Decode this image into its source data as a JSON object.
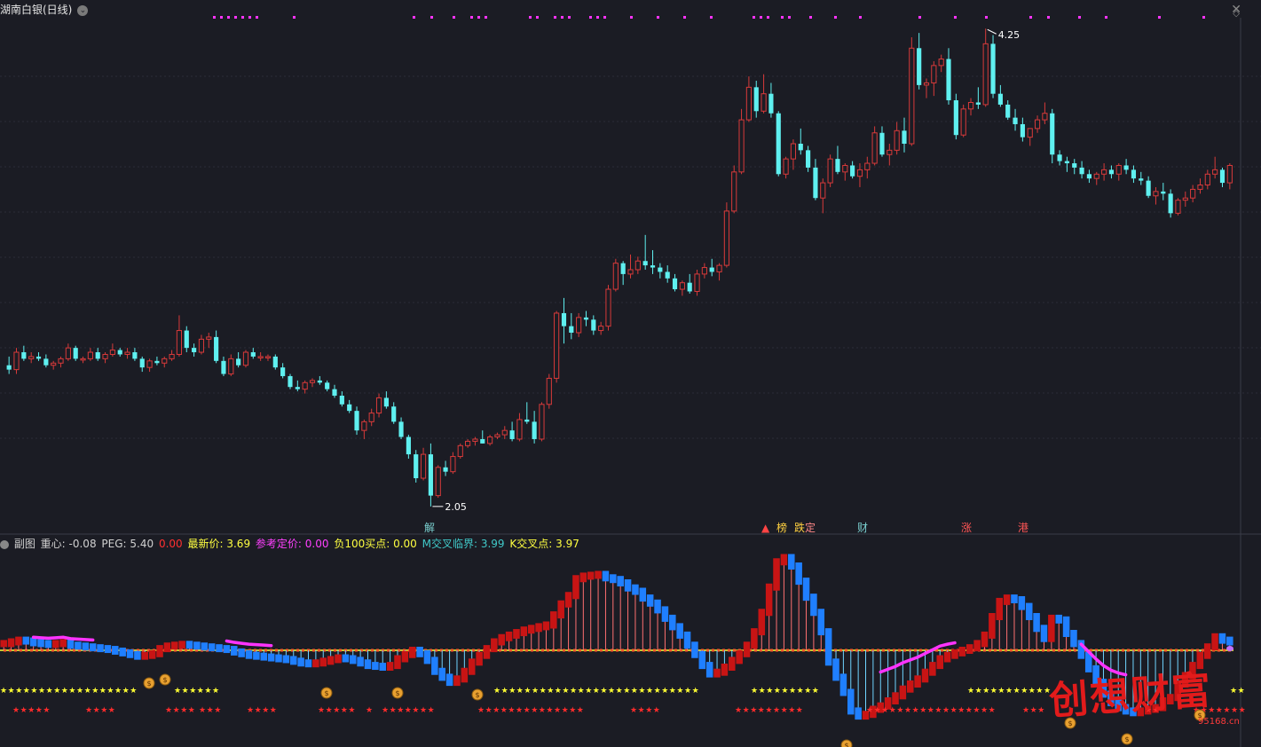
{
  "header": {
    "title": "湖南白银(日线)",
    "close_glyph": "✕",
    "diamond_glyph": "◇"
  },
  "colors": {
    "background": "#1b1c24",
    "up": "#d83a3a",
    "down": "#5ff0f0",
    "grid": "#2b2d38",
    "magenta": "#ff33ff",
    "yellow": "#ffff33",
    "red_star": "#ff2b2b",
    "blue_bar": "#1f7fff",
    "dark_red_bar": "#c81414"
  },
  "markers": {
    "high_label": "4.25",
    "low_label": "2.05",
    "event_tags": [
      {
        "text": "解",
        "color": "#7ad0d0"
      },
      {
        "text": "▲",
        "color": "#ff4444"
      },
      {
        "text": "榜",
        "color": "#ffd040"
      },
      {
        "text": "跌",
        "color": "#ffd040"
      },
      {
        "text": "定",
        "color": "#ff8888"
      },
      {
        "text": "财",
        "color": "#7ad0d0"
      },
      {
        "text": "涨",
        "color": "#ff5555"
      },
      {
        "text": "港",
        "color": "#ff5555"
      }
    ]
  },
  "sub_legend": [
    {
      "text": "副图",
      "color": "#d0d0d0"
    },
    {
      "text": "重心: -0.08",
      "color": "#d0d0d0"
    },
    {
      "text": "PEG: 5.40",
      "color": "#d0d0d0"
    },
    {
      "text": "0.00",
      "color": "#ff3030"
    },
    {
      "text": "最新价: 3.69",
      "color": "#ffff40"
    },
    {
      "text": "参考定价: 0.00",
      "color": "#ff40ff"
    },
    {
      "text": "负100买点: 0.00",
      "color": "#ffff40"
    },
    {
      "text": "M交叉临界: 3.99",
      "color": "#40c8c8"
    },
    {
      "text": "K交叉点: 3.97",
      "color": "#ffff40"
    }
  ],
  "watermark": {
    "text": "创想财富",
    "url": "95168.cn"
  },
  "chart_data": [
    {
      "type": "candlestick",
      "title": "湖南白银(日线)",
      "annotations": [
        {
          "label": "4.25",
          "kind": "max"
        },
        {
          "label": "2.05",
          "kind": "min"
        }
      ],
      "ohlc": [
        [
          2.7,
          2.74,
          2.66,
          2.68
        ],
        [
          2.68,
          2.78,
          2.66,
          2.76
        ],
        [
          2.76,
          2.79,
          2.72,
          2.73
        ],
        [
          2.73,
          2.76,
          2.71,
          2.74
        ],
        [
          2.74,
          2.76,
          2.72,
          2.73
        ],
        [
          2.73,
          2.75,
          2.69,
          2.7
        ],
        [
          2.7,
          2.72,
          2.68,
          2.71
        ],
        [
          2.71,
          2.74,
          2.69,
          2.73
        ],
        [
          2.73,
          2.8,
          2.72,
          2.78
        ],
        [
          2.78,
          2.79,
          2.72,
          2.73
        ],
        [
          2.73,
          2.74,
          2.71,
          2.73
        ],
        [
          2.73,
          2.78,
          2.72,
          2.76
        ],
        [
          2.76,
          2.78,
          2.72,
          2.73
        ],
        [
          2.73,
          2.76,
          2.71,
          2.75
        ],
        [
          2.75,
          2.8,
          2.74,
          2.77
        ],
        [
          2.77,
          2.78,
          2.74,
          2.75
        ],
        [
          2.75,
          2.78,
          2.73,
          2.76
        ],
        [
          2.76,
          2.78,
          2.72,
          2.73
        ],
        [
          2.73,
          2.74,
          2.67,
          2.69
        ],
        [
          2.69,
          2.73,
          2.67,
          2.72
        ],
        [
          2.72,
          2.74,
          2.7,
          2.71
        ],
        [
          2.71,
          2.74,
          2.69,
          2.73
        ],
        [
          2.73,
          2.77,
          2.72,
          2.75
        ],
        [
          2.75,
          2.93,
          2.74,
          2.86
        ],
        [
          2.86,
          2.88,
          2.76,
          2.78
        ],
        [
          2.78,
          2.8,
          2.74,
          2.76
        ],
        [
          2.76,
          2.84,
          2.75,
          2.82
        ],
        [
          2.82,
          2.85,
          2.78,
          2.83
        ],
        [
          2.83,
          2.86,
          2.71,
          2.72
        ],
        [
          2.72,
          2.74,
          2.65,
          2.66
        ],
        [
          2.66,
          2.75,
          2.65,
          2.73
        ],
        [
          2.73,
          2.76,
          2.69,
          2.7
        ],
        [
          2.7,
          2.77,
          2.69,
          2.76
        ],
        [
          2.76,
          2.78,
          2.73,
          2.74
        ],
        [
          2.74,
          2.76,
          2.72,
          2.74
        ],
        [
          2.74,
          2.75,
          2.72,
          2.74
        ],
        [
          2.74,
          2.75,
          2.68,
          2.69
        ],
        [
          2.69,
          2.71,
          2.64,
          2.65
        ],
        [
          2.65,
          2.66,
          2.59,
          2.6
        ],
        [
          2.6,
          2.63,
          2.58,
          2.59
        ],
        [
          2.59,
          2.63,
          2.57,
          2.62
        ],
        [
          2.62,
          2.64,
          2.6,
          2.63
        ],
        [
          2.63,
          2.65,
          2.61,
          2.62
        ],
        [
          2.62,
          2.63,
          2.58,
          2.59
        ],
        [
          2.59,
          2.61,
          2.55,
          2.56
        ],
        [
          2.56,
          2.58,
          2.51,
          2.52
        ],
        [
          2.52,
          2.54,
          2.48,
          2.49
        ],
        [
          2.49,
          2.51,
          2.38,
          2.4
        ],
        [
          2.4,
          2.45,
          2.36,
          2.44
        ],
        [
          2.44,
          2.5,
          2.42,
          2.48
        ],
        [
          2.48,
          2.57,
          2.46,
          2.55
        ],
        [
          2.55,
          2.58,
          2.5,
          2.51
        ],
        [
          2.51,
          2.53,
          2.43,
          2.44
        ],
        [
          2.44,
          2.46,
          2.36,
          2.37
        ],
        [
          2.37,
          2.38,
          2.27,
          2.29
        ],
        [
          2.29,
          2.31,
          2.16,
          2.18
        ],
        [
          2.18,
          2.32,
          2.17,
          2.29
        ],
        [
          2.29,
          2.34,
          2.05,
          2.1
        ],
        [
          2.1,
          2.24,
          2.09,
          2.23
        ],
        [
          2.23,
          2.26,
          2.19,
          2.21
        ],
        [
          2.21,
          2.3,
          2.2,
          2.28
        ],
        [
          2.28,
          2.34,
          2.27,
          2.33
        ],
        [
          2.33,
          2.36,
          2.32,
          2.35
        ],
        [
          2.35,
          2.37,
          2.33,
          2.36
        ],
        [
          2.36,
          2.4,
          2.34,
          2.34
        ],
        [
          2.34,
          2.38,
          2.33,
          2.37
        ],
        [
          2.37,
          2.39,
          2.36,
          2.38
        ],
        [
          2.38,
          2.42,
          2.36,
          2.4
        ],
        [
          2.4,
          2.44,
          2.35,
          2.36
        ],
        [
          2.36,
          2.48,
          2.35,
          2.45
        ],
        [
          2.45,
          2.53,
          2.43,
          2.44
        ],
        [
          2.44,
          2.49,
          2.34,
          2.36
        ],
        [
          2.36,
          2.53,
          2.35,
          2.52
        ],
        [
          2.52,
          2.66,
          2.5,
          2.64
        ],
        [
          2.64,
          2.95,
          2.62,
          2.94
        ],
        [
          2.94,
          3.01,
          2.8,
          2.88
        ],
        [
          2.88,
          2.94,
          2.82,
          2.85
        ],
        [
          2.85,
          2.94,
          2.83,
          2.92
        ],
        [
          2.92,
          2.95,
          2.88,
          2.91
        ],
        [
          2.91,
          2.93,
          2.84,
          2.86
        ],
        [
          2.86,
          2.9,
          2.84,
          2.88
        ],
        [
          2.88,
          3.07,
          2.86,
          3.05
        ],
        [
          3.05,
          3.19,
          3.04,
          3.17
        ],
        [
          3.17,
          3.18,
          3.07,
          3.12
        ],
        [
          3.12,
          3.21,
          3.1,
          3.14
        ],
        [
          3.14,
          3.2,
          3.12,
          3.18
        ],
        [
          3.18,
          3.3,
          3.14,
          3.16
        ],
        [
          3.16,
          3.23,
          3.12,
          3.15
        ],
        [
          3.15,
          3.17,
          3.1,
          3.13
        ],
        [
          3.13,
          3.16,
          3.08,
          3.1
        ],
        [
          3.1,
          3.12,
          3.04,
          3.05
        ],
        [
          3.05,
          3.09,
          3.02,
          3.08
        ],
        [
          3.08,
          3.12,
          3.03,
          3.04
        ],
        [
          3.04,
          3.14,
          3.02,
          3.12
        ],
        [
          3.12,
          3.17,
          3.1,
          3.15
        ],
        [
          3.15,
          3.19,
          3.11,
          3.13
        ],
        [
          3.13,
          3.17,
          3.09,
          3.16
        ],
        [
          3.16,
          3.45,
          3.15,
          3.41
        ],
        [
          3.41,
          3.62,
          3.4,
          3.59
        ],
        [
          3.59,
          3.88,
          3.58,
          3.83
        ],
        [
          3.83,
          4.03,
          3.82,
          3.98
        ],
        [
          3.98,
          4.01,
          3.84,
          3.87
        ],
        [
          3.87,
          4.04,
          3.86,
          3.95
        ],
        [
          3.95,
          4.0,
          3.84,
          3.86
        ],
        [
          3.86,
          3.87,
          3.57,
          3.58
        ],
        [
          3.58,
          3.66,
          3.56,
          3.65
        ],
        [
          3.65,
          3.74,
          3.6,
          3.72
        ],
        [
          3.72,
          3.79,
          3.67,
          3.69
        ],
        [
          3.69,
          3.71,
          3.59,
          3.61
        ],
        [
          3.61,
          3.65,
          3.46,
          3.47
        ],
        [
          3.47,
          3.56,
          3.4,
          3.54
        ],
        [
          3.54,
          3.67,
          3.52,
          3.65
        ],
        [
          3.65,
          3.71,
          3.58,
          3.59
        ],
        [
          3.59,
          3.63,
          3.55,
          3.62
        ],
        [
          3.62,
          3.64,
          3.56,
          3.57
        ],
        [
          3.57,
          3.63,
          3.52,
          3.6
        ],
        [
          3.6,
          3.66,
          3.56,
          3.63
        ],
        [
          3.63,
          3.8,
          3.62,
          3.77
        ],
        [
          3.77,
          3.8,
          3.66,
          3.67
        ],
        [
          3.67,
          3.72,
          3.62,
          3.69
        ],
        [
          3.69,
          3.82,
          3.67,
          3.78
        ],
        [
          3.78,
          3.84,
          3.68,
          3.72
        ],
        [
          3.72,
          4.21,
          3.71,
          4.16
        ],
        [
          4.16,
          4.23,
          3.97,
          3.99
        ],
        [
          3.99,
          4.02,
          3.93,
          4.0
        ],
        [
          4.0,
          4.1,
          3.94,
          4.08
        ],
        [
          4.08,
          4.13,
          4.05,
          4.11
        ],
        [
          4.11,
          4.16,
          3.9,
          3.92
        ],
        [
          3.92,
          3.95,
          3.74,
          3.76
        ],
        [
          3.76,
          3.9,
          3.75,
          3.88
        ],
        [
          3.88,
          3.93,
          3.85,
          3.91
        ],
        [
          3.91,
          3.98,
          3.88,
          3.9
        ],
        [
          3.9,
          4.25,
          3.89,
          4.18
        ],
        [
          4.18,
          4.22,
          3.93,
          3.95
        ],
        [
          3.95,
          3.99,
          3.89,
          3.9
        ],
        [
          3.9,
          3.92,
          3.83,
          3.84
        ],
        [
          3.84,
          3.88,
          3.78,
          3.81
        ],
        [
          3.81,
          3.84,
          3.73,
          3.75
        ],
        [
          3.75,
          3.79,
          3.71,
          3.79
        ],
        [
          3.79,
          3.85,
          3.77,
          3.83
        ],
        [
          3.83,
          3.91,
          3.81,
          3.86
        ],
        [
          3.86,
          3.88,
          3.63,
          3.67
        ],
        [
          3.67,
          3.69,
          3.62,
          3.64
        ],
        [
          3.64,
          3.66,
          3.59,
          3.63
        ],
        [
          3.63,
          3.65,
          3.58,
          3.61
        ],
        [
          3.61,
          3.64,
          3.56,
          3.58
        ],
        [
          3.58,
          3.6,
          3.54,
          3.56
        ],
        [
          3.56,
          3.59,
          3.53,
          3.58
        ],
        [
          3.58,
          3.63,
          3.55,
          3.6
        ],
        [
          3.6,
          3.62,
          3.56,
          3.58
        ],
        [
          3.58,
          3.63,
          3.55,
          3.62
        ],
        [
          3.62,
          3.65,
          3.58,
          3.6
        ],
        [
          3.6,
          3.62,
          3.54,
          3.56
        ],
        [
          3.56,
          3.59,
          3.53,
          3.55
        ],
        [
          3.55,
          3.57,
          3.47,
          3.48
        ],
        [
          3.48,
          3.52,
          3.44,
          3.5
        ],
        [
          3.5,
          3.54,
          3.46,
          3.49
        ],
        [
          3.49,
          3.51,
          3.38,
          3.4
        ],
        [
          3.4,
          3.47,
          3.39,
          3.46
        ],
        [
          3.46,
          3.5,
          3.43,
          3.47
        ],
        [
          3.47,
          3.53,
          3.45,
          3.51
        ],
        [
          3.51,
          3.56,
          3.49,
          3.53
        ],
        [
          3.53,
          3.6,
          3.51,
          3.58
        ],
        [
          3.58,
          3.66,
          3.56,
          3.6
        ],
        [
          3.6,
          3.61,
          3.52,
          3.54
        ],
        [
          3.54,
          3.63,
          3.51,
          3.62
        ]
      ]
    },
    {
      "type": "bar",
      "title": "副图",
      "values": [
        8,
        10,
        12,
        11,
        9,
        8,
        7,
        8,
        9,
        6,
        5,
        4,
        3,
        2,
        1,
        -1,
        -3,
        -5,
        -7,
        -6,
        -4,
        2,
        5,
        6,
        7,
        6,
        5,
        4,
        3,
        2,
        1,
        -2,
        -4,
        -6,
        -7,
        -8,
        -9,
        -10,
        -11,
        -13,
        -15,
        -16,
        -15,
        -13,
        -11,
        -9,
        -10,
        -12,
        -15,
        -18,
        -19,
        -20,
        -18,
        -10,
        -5,
        0,
        -4,
        -12,
        -25,
        -32,
        -38,
        -34,
        -25,
        -14,
        -6,
        2,
        10,
        15,
        18,
        21,
        24,
        26,
        28,
        30,
        42,
        55,
        65,
        85,
        88,
        89,
        90,
        86,
        84,
        80,
        74,
        70,
        62,
        56,
        48,
        38,
        28,
        18,
        6,
        -5,
        -18,
        -28,
        -26,
        -20,
        -12,
        -4,
        6,
        22,
        45,
        75,
        105,
        110,
        100,
        82,
        63,
        45,
        22,
        -14,
        -32,
        -50,
        -72,
        -78,
        -76,
        -70,
        -66,
        -60,
        -54,
        -46,
        -40,
        -34,
        -26,
        -18,
        -10,
        -6,
        -3,
        0,
        3,
        8,
        18,
        40,
        58,
        62,
        60,
        52,
        40,
        26,
        14,
        38,
        36,
        20,
        8,
        -6,
        -22,
        -38,
        -52,
        -62,
        -68,
        -72,
        -74,
        -72,
        -70,
        -68,
        -60,
        -56,
        -40,
        -30,
        -18,
        -6,
        4,
        16,
        12,
        10
      ]
    }
  ]
}
